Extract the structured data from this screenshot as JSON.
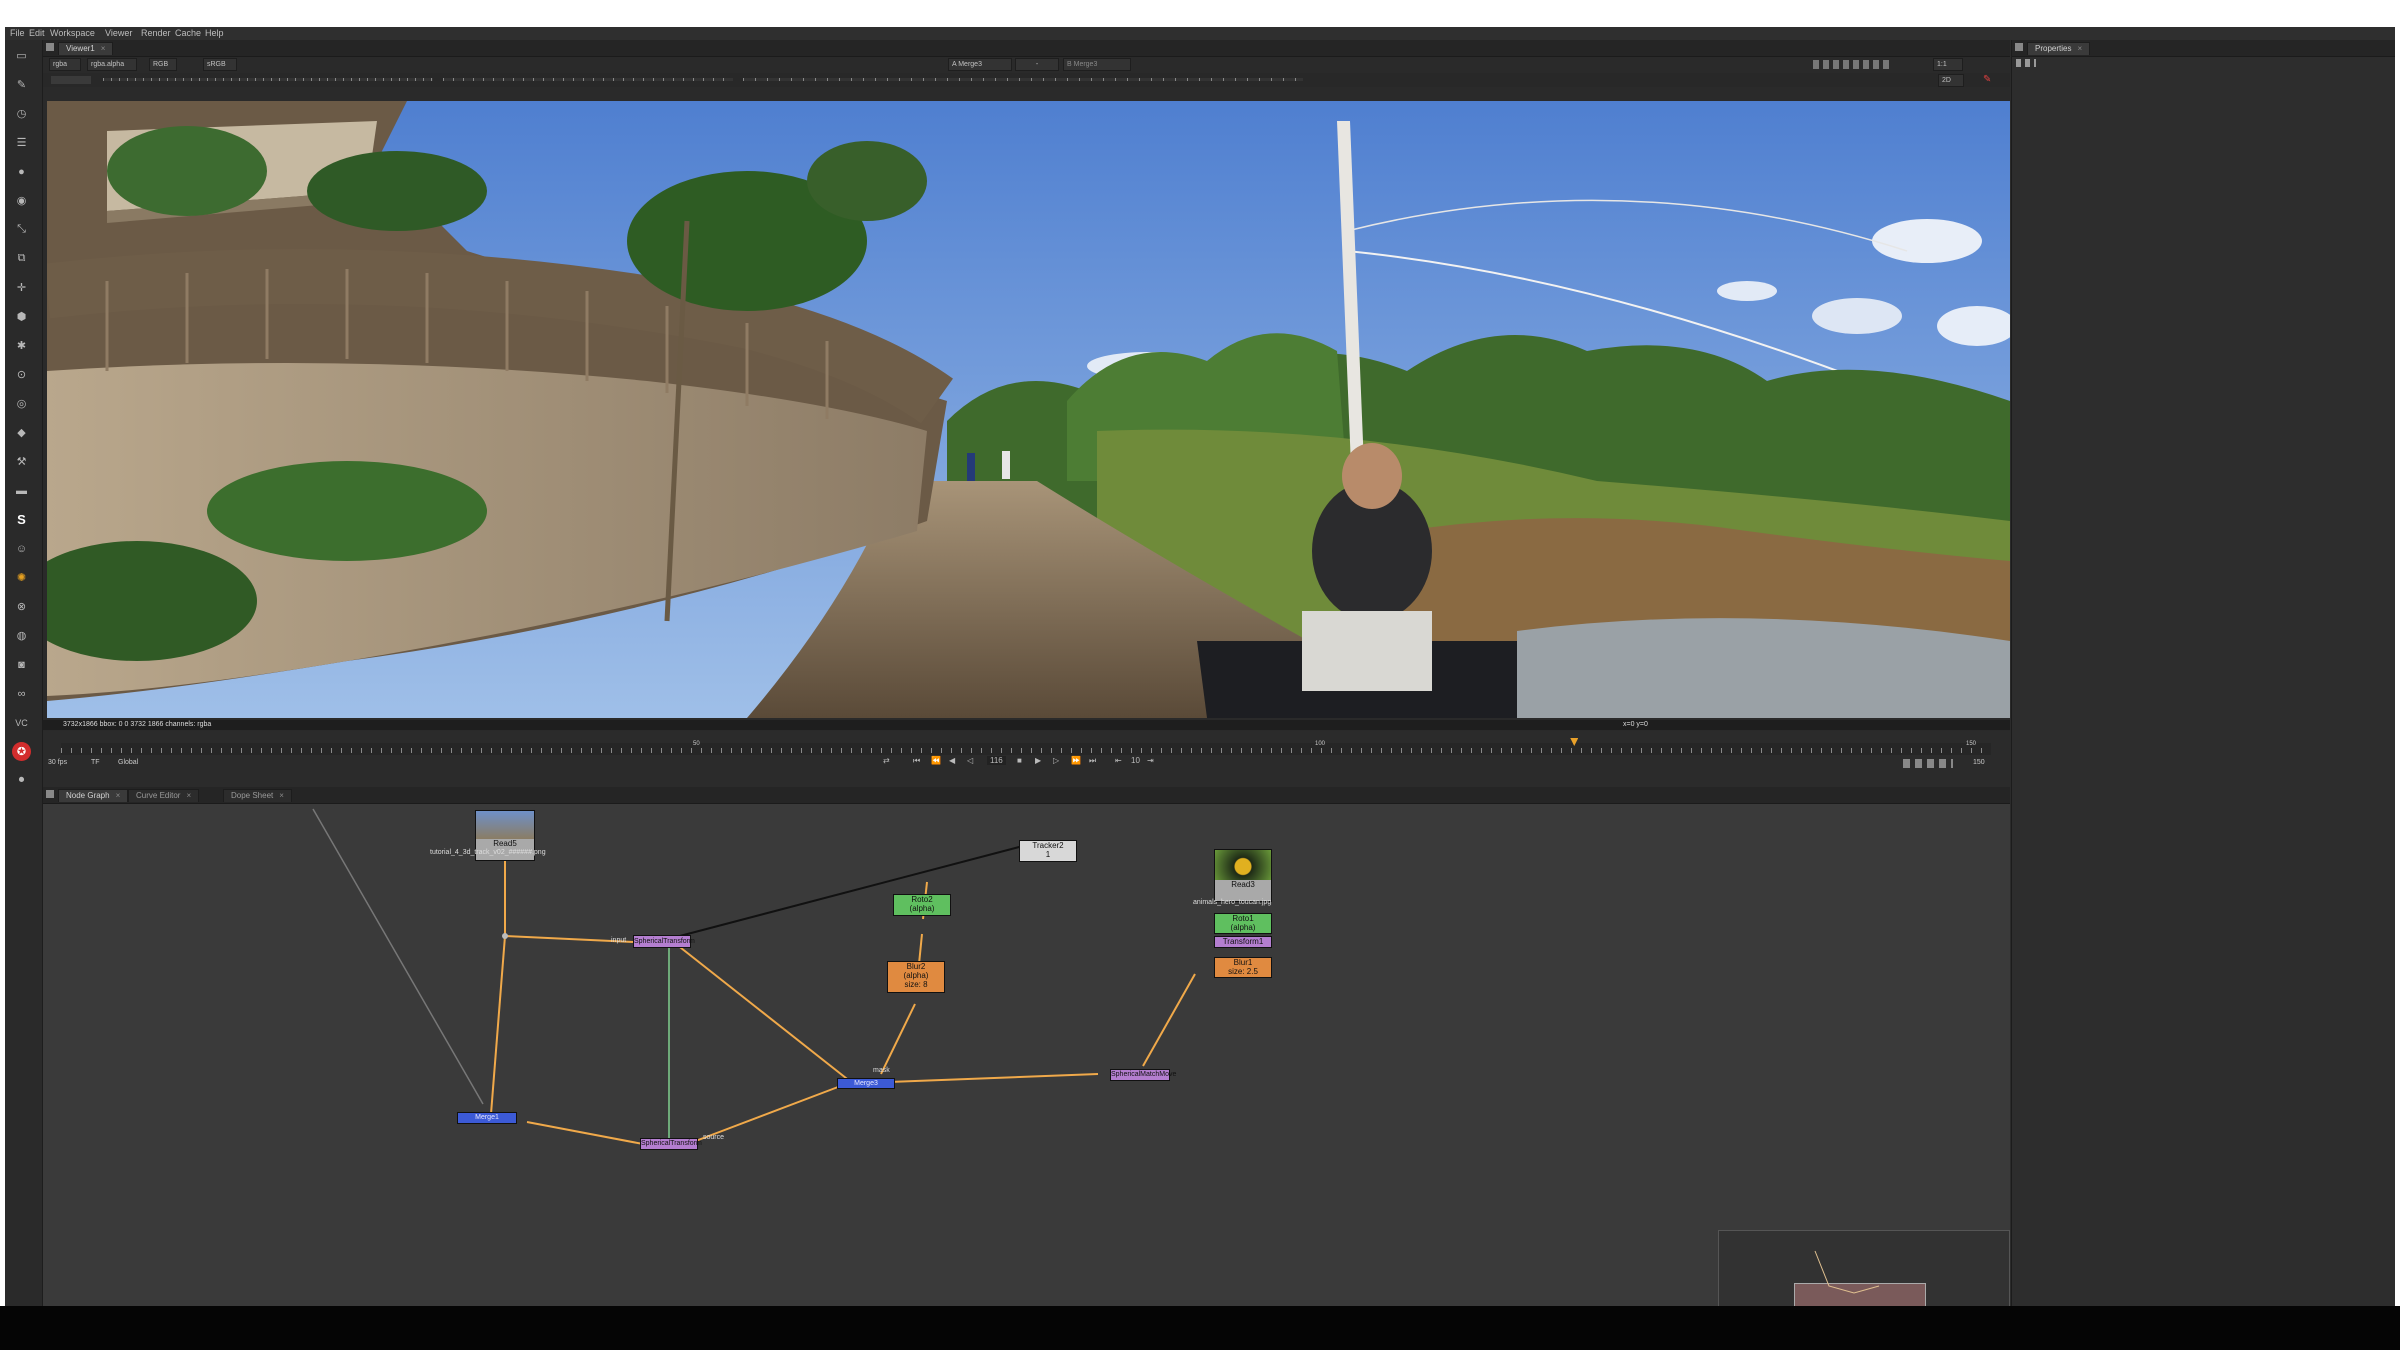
{
  "menu": [
    "File",
    "Edit",
    "Workspace",
    "Viewer",
    "Render",
    "Cache",
    "Help"
  ],
  "viewer_tab": "Viewer1",
  "viewer_controls": {
    "channels": "rgba",
    "layer": "rgba.alpha",
    "color": "RGB",
    "lut": "sRGB",
    "input_a": "A  Merge3",
    "input_dash": "-",
    "input_b": "B  Merge3",
    "zoom": "1:1",
    "view_mode": "2D"
  },
  "viewer_info": "3732x1866  bbox: 0 0 3732 1866 channels: rgba",
  "viewer_coords": "x=0 y=0",
  "timeline": {
    "fps": "30 fps",
    "tf": "TF",
    "global": "Global",
    "current_frame": "116",
    "step": "10",
    "end_frame": "150",
    "tick_labels": [
      "50",
      "100"
    ],
    "tick_end": "150",
    "playhead_fraction": 0.782
  },
  "node_tabs": [
    "Node Graph",
    "Curve Editor",
    "Dope Sheet"
  ],
  "properties_tab": "Properties",
  "nodes": {
    "read5": {
      "title": "Read5",
      "file": "tutorial_4_3d_track_v02_######.png"
    },
    "tracker2": {
      "title": "Tracker2",
      "sub": "1"
    },
    "roto2": {
      "title": "Roto2",
      "sub": "(alpha)"
    },
    "blur2": {
      "title": "Blur2",
      "sub1": "(alpha)",
      "sub2": "size: 8"
    },
    "read3": {
      "title": "Read3",
      "file": "animals_hero_toucan.jpg"
    },
    "roto1": {
      "title": "Roto1",
      "sub": "(alpha)"
    },
    "transform1": {
      "title": "Transform1"
    },
    "blur1": {
      "title": "Blur1",
      "sub": "size: 2.5"
    },
    "spherical_transform_top": {
      "title": "SphericalTransform"
    },
    "merge_center": {
      "title": "Merge3"
    },
    "spherical_transform_bottom": {
      "title": "SphericalTransform"
    },
    "merge_left": {
      "title": "Merge1"
    },
    "match_node": {
      "title": "SphericalMatchMove"
    },
    "labels": {
      "mask": "mask",
      "source": "source",
      "input": "input"
    }
  },
  "colors": {
    "read": "#a9a9a9",
    "roto": "#5fbf5f",
    "blur": "#e08a40",
    "transform": "#b47ed0",
    "merge": "#3c5ad6",
    "pipe": "#f0a94a",
    "tracker": "#d8d8d8"
  }
}
